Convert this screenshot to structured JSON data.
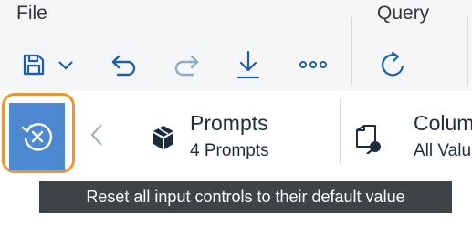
{
  "toolbar": {
    "file_label": "File",
    "query_label": "Query",
    "icons": [
      "save-icon",
      "chevron-down-icon",
      "undo-icon",
      "redo-icon",
      "download-icon",
      "more-icon",
      "refresh-icon"
    ]
  },
  "prompts_bar": {
    "reset_icon": "reset-icon",
    "prompts_title": "Prompts",
    "prompts_count": "4 Prompts",
    "columns_title": "Colum",
    "columns_sub": "All Valu"
  },
  "tooltip": {
    "text": "Reset all input controls to their default value"
  },
  "background_text": "...",
  "colors": {
    "accent_blue": "#4d89d0",
    "highlight_orange": "#f0952f",
    "tooltip_bg": "#3e4347",
    "icon_blue": "#1f5fa9"
  }
}
